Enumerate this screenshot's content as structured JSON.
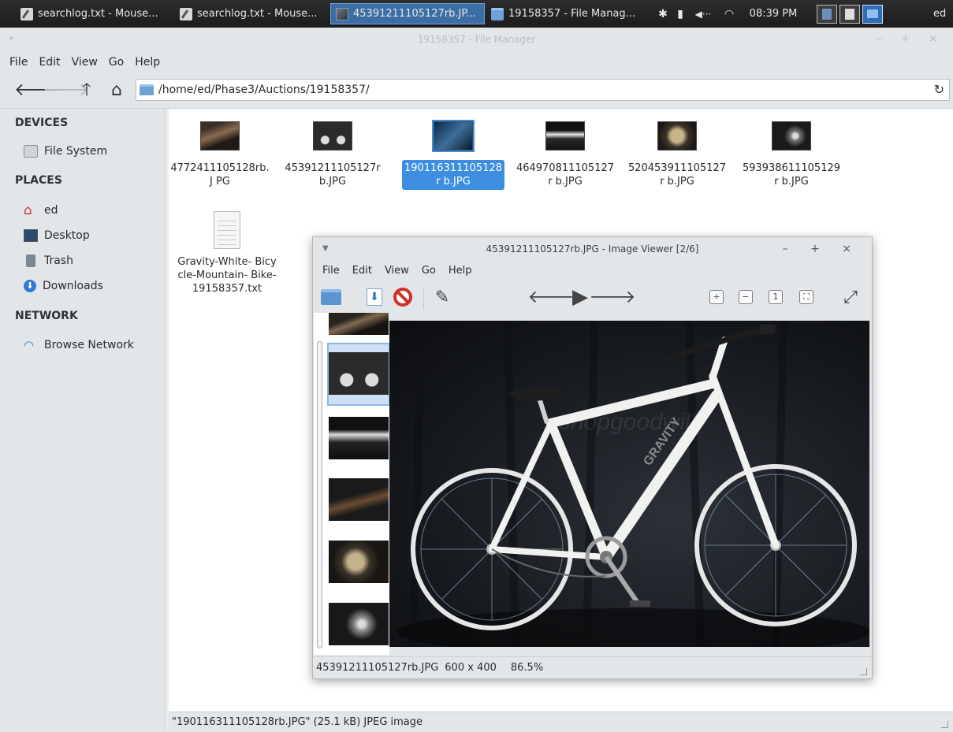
{
  "taskbar": {
    "tasks": [
      {
        "label": "searchlog.txt - Mouse..."
      },
      {
        "label": "searchlog.txt - Mouse..."
      },
      {
        "label": "45391211105127rb.JP..."
      },
      {
        "label": "19158357 - File Manag..."
      }
    ],
    "clock": "08:39 PM",
    "user": "ed"
  },
  "file_manager": {
    "title": "19158357 - File Manager",
    "menu": [
      "File",
      "Edit",
      "View",
      "Go",
      "Help"
    ],
    "location": "/home/ed/Phase3/Auctions/19158357/",
    "sidebar": {
      "devices_heading": "DEVICES",
      "devices": [
        {
          "label": "File System",
          "icon": "drive-icon"
        }
      ],
      "places_heading": "PLACES",
      "places": [
        {
          "label": "ed",
          "icon": "home-icon"
        },
        {
          "label": "Desktop",
          "icon": "desktop-icon"
        },
        {
          "label": "Trash",
          "icon": "trash-icon"
        },
        {
          "label": "Downloads",
          "icon": "download-icon"
        }
      ],
      "network_heading": "NETWORK",
      "network": [
        {
          "label": "Browse Network",
          "icon": "wifi-icon"
        }
      ]
    },
    "files": [
      {
        "name": "4772411105128rb.JPG",
        "display": "4772411105128rb.J PG",
        "selected": false
      },
      {
        "name": "45391211105127rb.JPG",
        "display": "45391211105127r b.JPG",
        "selected": false
      },
      {
        "name": "190116311105128rb.JPG",
        "display": "190116311105128r b.JPG",
        "selected": true
      },
      {
        "name": "464970811105127rb.JPG",
        "display": "464970811105127r b.JPG",
        "selected": false
      },
      {
        "name": "520453911105127rb.JPG",
        "display": "520453911105127r b.JPG",
        "selected": false
      },
      {
        "name": "593938611105129rb.JPG",
        "display": "593938611105129r b.JPG",
        "selected": false
      },
      {
        "name": "Gravity-White-Bicycle-Mountain-Bike-19158357.txt",
        "display": "Gravity-White- Bicycle-Mountain- Bike-19158357.txt",
        "selected": false
      }
    ],
    "status": "\"190116311105128rb.JPG\" (25.1 kB) JPEG image"
  },
  "image_viewer": {
    "title": "45391211105127rb.JPG - Image Viewer [2/6]",
    "menu": [
      "File",
      "Edit",
      "View",
      "Go",
      "Help"
    ],
    "status": {
      "filename": "45391211105127rb.JPG",
      "dimensions": "600 x 400",
      "zoom": "86.5%"
    },
    "photo_watermark": "shopgoodwill",
    "photo_brand_text": "GRAVITY"
  },
  "colors": {
    "selection": "#3d8ee0",
    "panel": "#e3e6e9",
    "taskbar": "#1c1c1c"
  }
}
